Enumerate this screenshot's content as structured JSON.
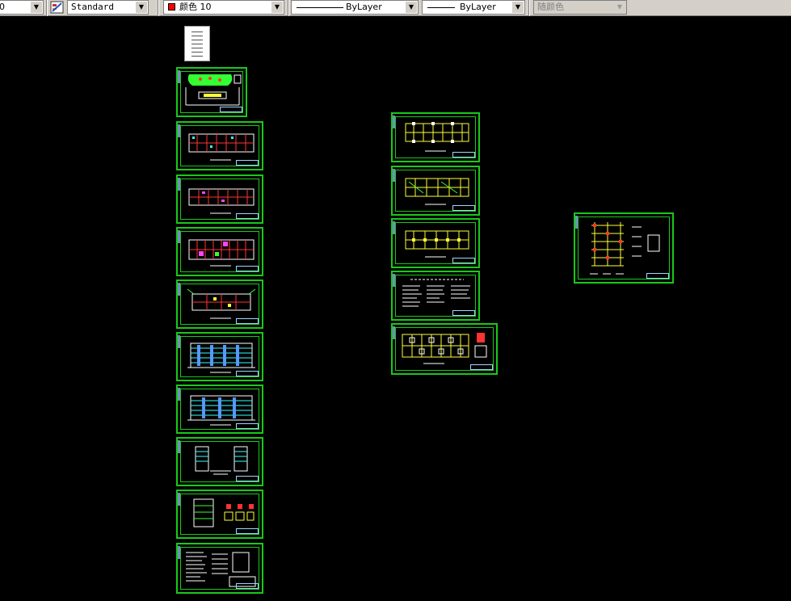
{
  "toolbar": {
    "layer_combo": {
      "value": "0"
    },
    "text_style": {
      "value": "Standard"
    },
    "color_combo": {
      "value": "颜色 10",
      "swatch": "#ff0000"
    },
    "linetype_combo": {
      "value": "ByLayer"
    },
    "lineweight_combo": {
      "value": "ByLayer"
    },
    "plotstyle_combo": {
      "value": "随颜色"
    }
  },
  "colors": {
    "canvas": "#000000",
    "frame": "#19c919",
    "plan_yellow": "#ffff33",
    "plan_red": "#ff3333",
    "plan_cyan": "#33ffff",
    "plan_white": "#ffffff",
    "plan_magenta": "#ff44ff"
  },
  "icons": [
    "chevron-down-icon",
    "text-style-icon",
    "color-swatch-icon",
    "line-sample-icon"
  ]
}
